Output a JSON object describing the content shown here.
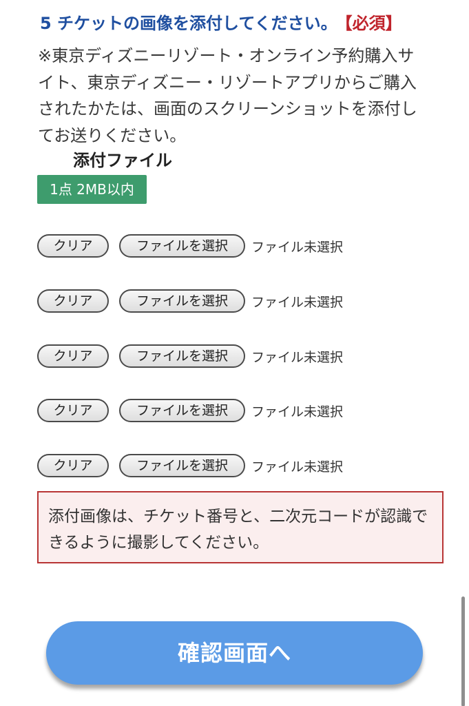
{
  "section": {
    "title": "5 チケットの画像を添付してください。",
    "required": "【必須】"
  },
  "instructions": "※東京ディズニーリゾート・オンライン予約購入サイト、東京ディズニー・リゾートアプリからご購入されたかたは、画面のスクリーンショットを添付してお送りください。",
  "attachment": {
    "label": "添付ファイル",
    "limit": "1点 2MB以内",
    "rows": [
      {
        "clear": "クリア",
        "choose": "ファイルを選択",
        "status": "ファイル未選択"
      },
      {
        "clear": "クリア",
        "choose": "ファイルを選択",
        "status": "ファイル未選択"
      },
      {
        "clear": "クリア",
        "choose": "ファイルを選択",
        "status": "ファイル未選択"
      },
      {
        "clear": "クリア",
        "choose": "ファイルを選択",
        "status": "ファイル未選択"
      },
      {
        "clear": "クリア",
        "choose": "ファイルを選択",
        "status": "ファイル未選択"
      }
    ]
  },
  "notice": "添付画像は、チケット番号と、二次元コードが認識できるように撮影してください。",
  "confirm_button": "確認画面へ",
  "colors": {
    "title": "#1f4fa0",
    "required": "#c0242c",
    "badge": "#3e9c6d",
    "notice_border": "#b83434",
    "notice_bg": "#fbeeee",
    "button": "#5b9be6"
  }
}
